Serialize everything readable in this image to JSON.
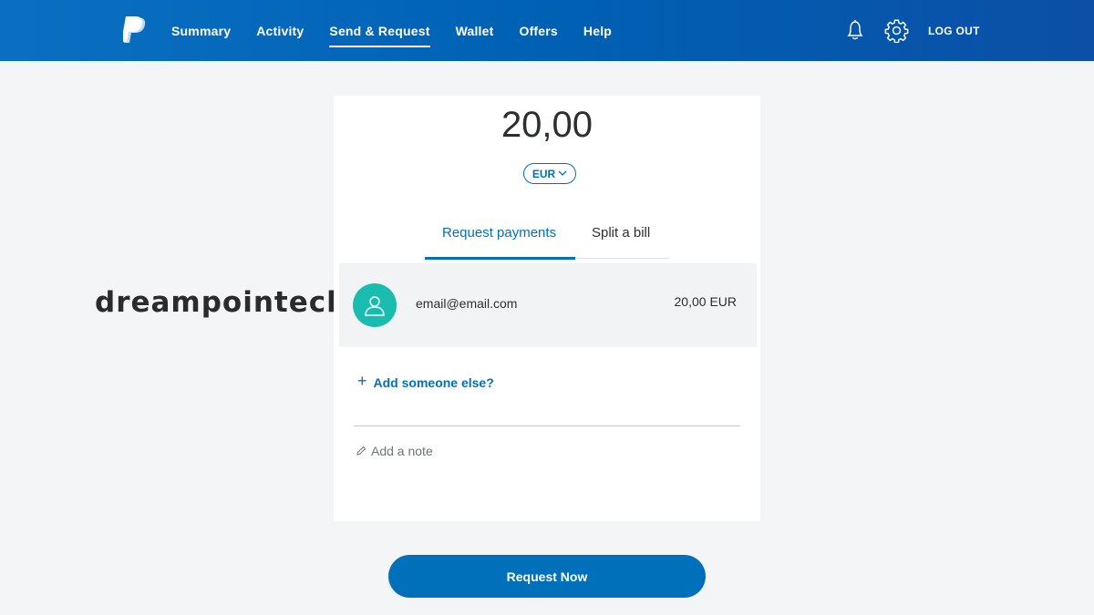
{
  "header": {
    "nav": [
      {
        "label": "Summary",
        "active": false
      },
      {
        "label": "Activity",
        "active": false
      },
      {
        "label": "Send & Request",
        "active": true
      },
      {
        "label": "Wallet",
        "active": false
      },
      {
        "label": "Offers",
        "active": false
      },
      {
        "label": "Help",
        "active": false
      }
    ],
    "icons": [
      "paypal-logo-icon",
      "bell-icon",
      "gear-icon"
    ],
    "logout_label": "LOG OUT"
  },
  "watermark": "dreampointech",
  "request": {
    "amount": "20,00",
    "currency": "EUR",
    "tabs": [
      {
        "label": "Request payments",
        "active": true
      },
      {
        "label": "Split a bill",
        "active": false
      }
    ],
    "recipient": {
      "email": "email@email.com",
      "amount": "20,00 EUR"
    },
    "add_someone_label": "Add someone else?",
    "note_placeholder": "Add a note",
    "submit_label": "Request Now"
  },
  "colors": {
    "brand_blue": "#0070ba",
    "avatar_teal": "#1abcb0",
    "page_bg": "#f4f5f7"
  }
}
